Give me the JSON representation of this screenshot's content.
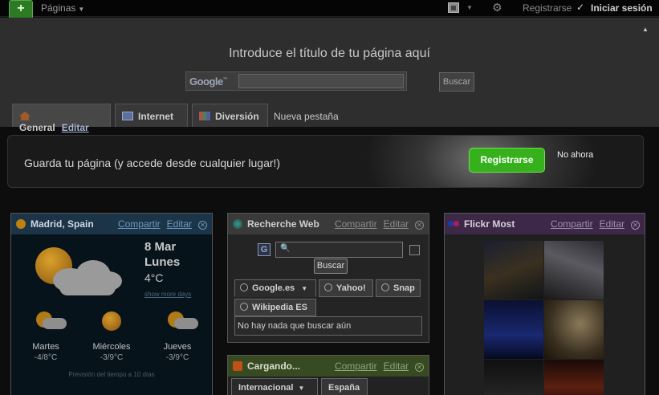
{
  "topbar": {
    "add_label": "+",
    "pages_label": "Páginas",
    "register_label": "Registrarse",
    "login_label": "Iniciar sesión"
  },
  "header": {
    "page_title": "Introduce el título de tu página aquí",
    "search_input_value": "",
    "search_button_label": "Buscar"
  },
  "tabs": [
    {
      "label": "General",
      "edit_label": "Editar",
      "active": true
    },
    {
      "label": "Internet"
    },
    {
      "label": "Diversión"
    }
  ],
  "new_tab_label": "Nueva pestaña",
  "banner": {
    "text": "Guarda tu página (y accede desde cualquier lugar!)",
    "register_button": "Registrarse",
    "not_now": "No ahora"
  },
  "weather": {
    "title": "Madrid, Spain",
    "share": "Compartir",
    "edit": "Editar",
    "date": "8 Mar",
    "day": "Lunes",
    "temp": "4°C",
    "show_more": "show more days",
    "forecast": [
      {
        "day": "Martes",
        "temp": "-4/8°C",
        "icon": "sun-cloud"
      },
      {
        "day": "Miércoles",
        "temp": "-3/9°C",
        "icon": "sun"
      },
      {
        "day": "Jueves",
        "temp": "-3/9°C",
        "icon": "sun-cloud"
      }
    ],
    "note": "Previsión del tiempo a 10 días"
  },
  "web_search": {
    "title": "Recherche Web",
    "share": "Compartir",
    "edit": "Editar",
    "search_value": "",
    "button": "Buscar",
    "engines": [
      "Google.es",
      "Yahoo!",
      "Snap",
      "Wikipedia ES"
    ],
    "results": "No hay nada que buscar aún"
  },
  "flickr": {
    "title": "Flickr Most",
    "share": "Compartir",
    "edit": "Editar"
  },
  "loading": {
    "title": "Cargando...",
    "share": "Compartir",
    "edit": "Editar",
    "tabs": [
      "Internacional",
      "España"
    ]
  },
  "colors": {
    "accent_green": "#36b11d",
    "link_blue": "#6e9bc0"
  }
}
